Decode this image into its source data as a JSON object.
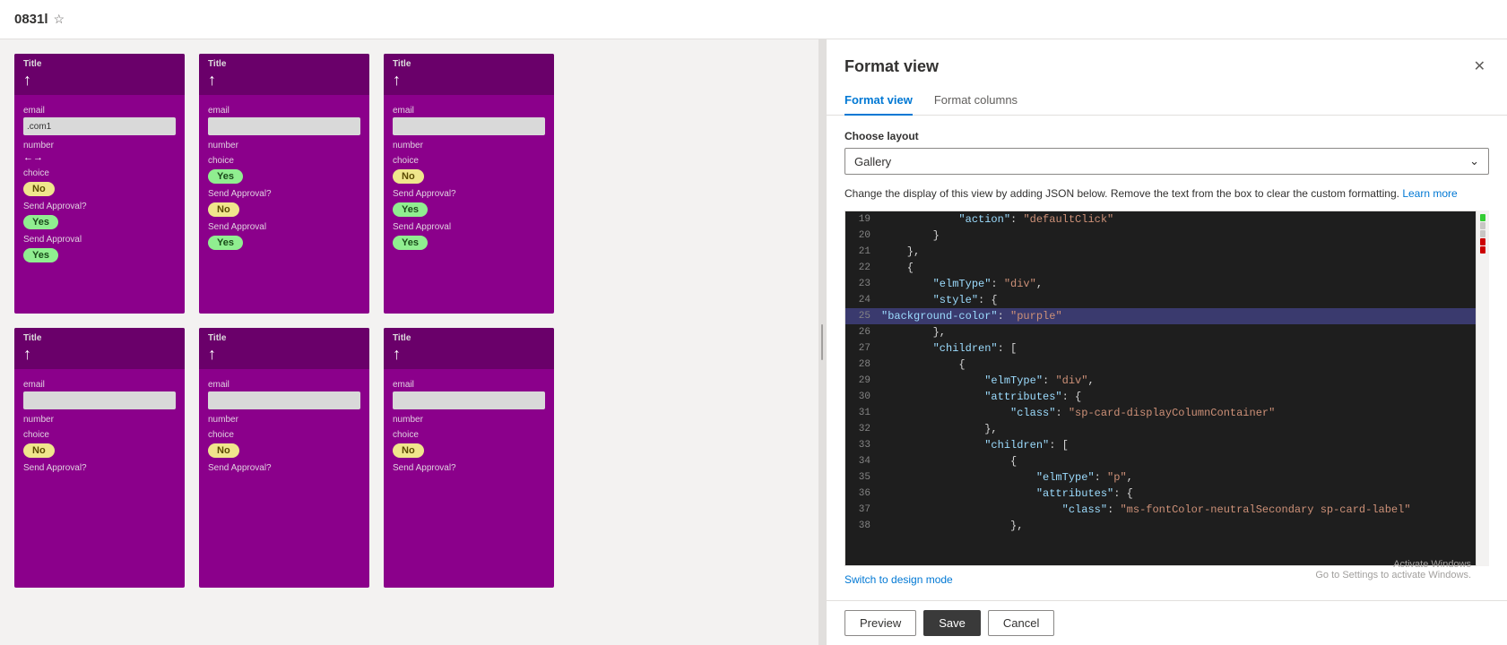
{
  "topbar": {
    "title": "0831l",
    "star": "☆"
  },
  "panel": {
    "title": "Format view",
    "close": "✕",
    "tabs": [
      {
        "label": "Format view",
        "active": true
      },
      {
        "label": "Format columns",
        "active": false
      }
    ],
    "choose_layout_label": "Choose layout",
    "layout_value": "Gallery",
    "description": "Change the display of this view by adding JSON below. Remove the text from the box to clear the custom formatting.",
    "learn_more": "Learn more",
    "switch_design": "Switch to design mode",
    "buttons": {
      "preview": "Preview",
      "save": "Save",
      "cancel": "Cancel"
    },
    "activate_windows": "Activate Windows",
    "activate_windows_sub": "Go to Settings to activate Windows."
  },
  "cards": [
    {
      "id": 1,
      "title": "Title",
      "icon": "↑",
      "email_label": "email",
      "email_value": ".com1",
      "number_label": "number",
      "number_value": "←→",
      "choice_label": "choice",
      "choice": "No",
      "choice_type": "no",
      "send_approval_label": "Send Approval?",
      "send_approval": "Yes",
      "send_approval_type": "yes",
      "send_approval2_label": "Send Approval",
      "send_approval2": "Yes",
      "send_approval2_type": "yes"
    },
    {
      "id": 2,
      "title": "Title",
      "icon": "↑",
      "email_label": "email",
      "email_value": "",
      "number_label": "number",
      "number_value": "",
      "choice_label": "choice",
      "choice": "Yes",
      "choice_type": "yes",
      "send_approval_label": "Send Approval?",
      "send_approval": "No",
      "send_approval_type": "no",
      "send_approval2_label": "Send Approval",
      "send_approval2": "Yes",
      "send_approval2_type": "yes"
    },
    {
      "id": 3,
      "title": "Title",
      "icon": "↑",
      "email_label": "email",
      "email_value": "",
      "number_label": "number",
      "number_value": "",
      "choice_label": "choice",
      "choice": "No",
      "choice_type": "no",
      "send_approval_label": "Send Approval?",
      "send_approval": "Yes",
      "send_approval_type": "yes",
      "send_approval2_label": "Send Approval",
      "send_approval2": "Yes",
      "send_approval2_type": "yes"
    },
    {
      "id": 4,
      "title": "Title",
      "icon": "↑",
      "email_label": "email",
      "email_value": "",
      "number_label": "number",
      "number_value": "",
      "choice_label": "choice",
      "choice": "No",
      "choice_type": "no",
      "send_approval_label": "Send Approval?",
      "send_approval": "",
      "send_approval_type": "none"
    },
    {
      "id": 5,
      "title": "Title",
      "icon": "↑",
      "email_label": "email",
      "email_value": "",
      "number_label": "number",
      "number_value": "",
      "choice_label": "choice",
      "choice": "No",
      "choice_type": "no",
      "send_approval_label": "Send Approval?",
      "send_approval": "",
      "send_approval_type": "none"
    },
    {
      "id": 6,
      "title": "Title",
      "icon": "↑",
      "email_label": "email",
      "email_value": "",
      "number_label": "number",
      "number_value": "",
      "choice_label": "choice",
      "choice": "No",
      "choice_type": "no",
      "send_approval_label": "Send Approval?",
      "send_approval": "",
      "send_approval_type": "none"
    }
  ],
  "code_lines": [
    {
      "num": 19,
      "content": "            \"action\": \"defaultClick\"",
      "highlight": false
    },
    {
      "num": 20,
      "content": "        }",
      "highlight": false
    },
    {
      "num": 21,
      "content": "    },",
      "highlight": false
    },
    {
      "num": 22,
      "content": "    {",
      "highlight": false
    },
    {
      "num": 23,
      "content": "        \"elmType\": \"div\",",
      "highlight": false
    },
    {
      "num": 24,
      "content": "        \"style\": {",
      "highlight": false
    },
    {
      "num": 25,
      "content": "\"background-color\": \"purple\"",
      "highlight": true
    },
    {
      "num": 26,
      "content": "        },",
      "highlight": false
    },
    {
      "num": 27,
      "content": "        \"children\": [",
      "highlight": false
    },
    {
      "num": 28,
      "content": "            {",
      "highlight": false
    },
    {
      "num": 29,
      "content": "                \"elmType\": \"div\",",
      "highlight": false
    },
    {
      "num": 30,
      "content": "                \"attributes\": {",
      "highlight": false
    },
    {
      "num": 31,
      "content": "                    \"class\": \"sp-card-displayColumnContainer\"",
      "highlight": false
    },
    {
      "num": 32,
      "content": "                },",
      "highlight": false
    },
    {
      "num": 33,
      "content": "                \"children\": [",
      "highlight": false
    },
    {
      "num": 34,
      "content": "                    {",
      "highlight": false
    },
    {
      "num": 35,
      "content": "                        \"elmType\": \"p\",",
      "highlight": false
    },
    {
      "num": 36,
      "content": "                        \"attributes\": {",
      "highlight": false
    },
    {
      "num": 37,
      "content": "                            \"class\": \"ms-fontColor-neutralSecondary sp-card-label\"",
      "highlight": false
    },
    {
      "num": 38,
      "content": "                    },",
      "highlight": false
    }
  ]
}
